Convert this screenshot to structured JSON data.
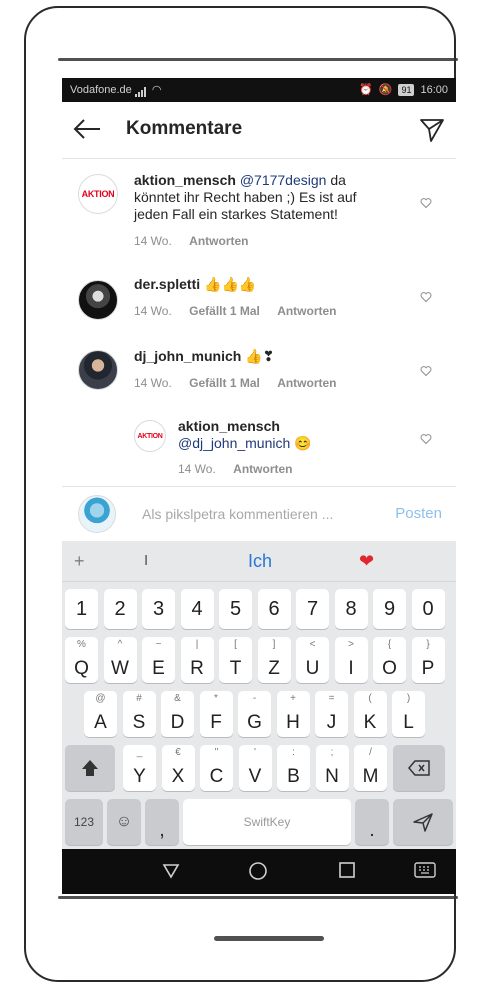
{
  "status": {
    "carrier": "Vodafone.de",
    "battery": "91",
    "time": "16:00"
  },
  "header": {
    "title": "Kommentare"
  },
  "comments": [
    {
      "user": "aktion_mensch",
      "mention": "@7177design",
      "text": " da könntet ihr Recht haben ;) Es ist auf jeden Fall ein starkes Statement!",
      "time": "14 Wo.",
      "reply": "Antworten",
      "avatar_text": "AKTION"
    },
    {
      "user": "der.spletti",
      "emoji": "👍👍👍",
      "time": "14 Wo.",
      "likes": "Gefällt 1 Mal",
      "reply": "Antworten"
    },
    {
      "user": "dj_john_munich",
      "emoji": "👍❣",
      "time": "14 Wo.",
      "likes": "Gefällt 1 Mal",
      "reply": "Antworten"
    },
    {
      "user": "aktion_mensch",
      "mention": "@dj_john_munich",
      "emoji": " 😊",
      "time": "14 Wo.",
      "reply": "Antworten",
      "avatar_text": "AKTION"
    }
  ],
  "composer": {
    "placeholder": "Als pikslpetra kommentieren ...",
    "post": "Posten"
  },
  "keyboard": {
    "suggest": {
      "plus": "+",
      "s1": "I",
      "s2": "Ich",
      "s3": "❤"
    },
    "numbers": [
      "1",
      "2",
      "3",
      "4",
      "5",
      "6",
      "7",
      "8",
      "9",
      "0"
    ],
    "row1": [
      [
        "Q",
        "%"
      ],
      [
        "W",
        "^"
      ],
      [
        "E",
        "~"
      ],
      [
        "R",
        "|"
      ],
      [
        "T",
        "["
      ],
      [
        "Z",
        "]"
      ],
      [
        "U",
        "<"
      ],
      [
        "I",
        ">"
      ],
      [
        "O",
        "{"
      ],
      [
        "P",
        "}"
      ]
    ],
    "row2": [
      [
        "A",
        "@"
      ],
      [
        "S",
        "#"
      ],
      [
        "D",
        "&"
      ],
      [
        "F",
        "*"
      ],
      [
        "G",
        "-"
      ],
      [
        "H",
        "+"
      ],
      [
        "J",
        "="
      ],
      [
        "K",
        "("
      ],
      [
        "L",
        ")"
      ]
    ],
    "row3": [
      [
        "Y",
        "_"
      ],
      [
        "X",
        "€"
      ],
      [
        "C",
        "\""
      ],
      [
        "V",
        "'"
      ],
      [
        "B",
        ":"
      ],
      [
        "N",
        ";"
      ],
      [
        "M",
        "/"
      ]
    ],
    "bottom": {
      "k123": "123",
      "comma": ",",
      "space": "SwiftKey",
      "period": "."
    }
  },
  "colors": {
    "accent": "#8ec0ee",
    "mention": "#1f3a7a",
    "brand_red": "#e3001b"
  }
}
